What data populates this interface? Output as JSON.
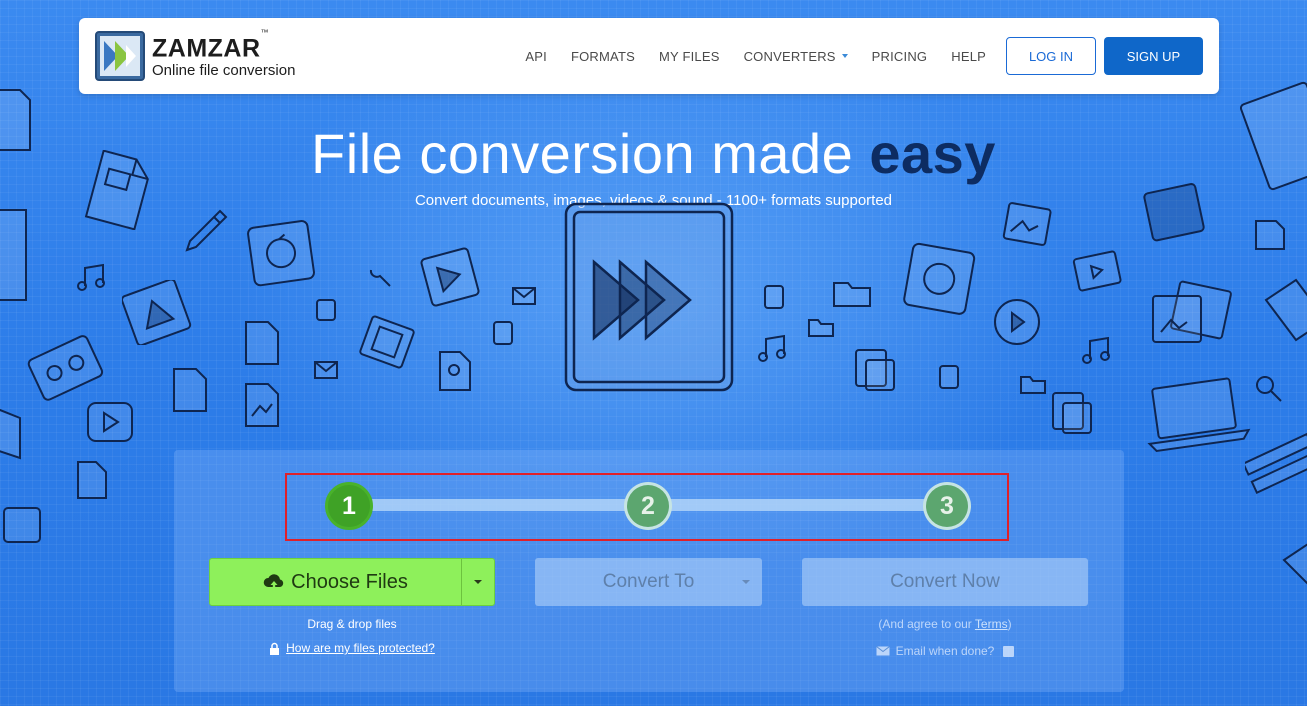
{
  "brand": {
    "name": "ZAMZAR",
    "trademark": "™",
    "tagline": "Online file conversion"
  },
  "nav": {
    "items": [
      {
        "label": "API"
      },
      {
        "label": "FORMATS"
      },
      {
        "label": "MY FILES"
      },
      {
        "label": "CONVERTERS"
      },
      {
        "label": "PRICING"
      },
      {
        "label": "HELP"
      }
    ],
    "login_label": "LOG IN",
    "signup_label": "SIGN UP"
  },
  "hero": {
    "title_main": "File conversion made",
    "title_emphasis": "easy",
    "subtitle": "Convert documents, images, videos & sound - 1100+ formats supported"
  },
  "steps": [
    "1",
    "2",
    "3"
  ],
  "converter": {
    "choose_files_label": "Choose Files",
    "convert_to_label": "Convert To",
    "convert_now_label": "Convert Now",
    "drag_drop_text": "Drag & drop files",
    "protected_link": "How are my files protected?",
    "agree_prefix": "(And agree to our ",
    "terms_link": "Terms",
    "agree_suffix": ")",
    "email_label": "Email when done?"
  },
  "colors": {
    "background": "#2a78e4",
    "header_bg": "#ffffff",
    "primary": "#0f67c9",
    "choose_files": "#8ef05b",
    "step_active": "#3fa226",
    "step_inactive": "#5ca66f",
    "highlight_border": "#e0202a",
    "title_emphasis": "#0d2c62"
  },
  "icons": {
    "logo": "zamzar-logo-icon",
    "upload": "cloud-upload-icon",
    "lock": "lock-icon",
    "email": "envelope-icon",
    "hero": "fast-forward-icon"
  }
}
